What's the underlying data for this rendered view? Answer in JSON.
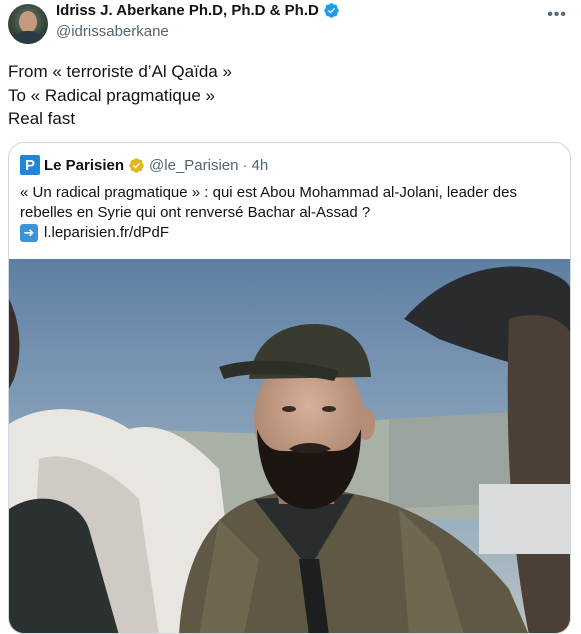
{
  "author": {
    "name": "Idriss J. Aberkane Ph.D, Ph.D & Ph.D",
    "handle": "@idrissaberkane",
    "more_icon": "more-horizontal-icon"
  },
  "tweet": {
    "lines": [
      "From « terroriste d’Al Qaïda »",
      "To « Radical pragmatique »",
      "Real fast"
    ]
  },
  "quote": {
    "logo_letter": "P",
    "source_name": "Le Parisien",
    "source_handle": "@le_Parisien",
    "separator": "·",
    "time": "4h",
    "text_line1": "« Un radical pragmatique » : qui est Abou Mohammad al-Jolani, leader des",
    "text_line2": "rebelles en Syrie qui ont renversé Bachar al-Assad ?",
    "link_text": "l.leparisien.fr/dPdF",
    "photo_label": "photo of a bearded man in a dark cap and olive jacket"
  },
  "colors": {
    "verified_blue": "#1d9bf0",
    "verified_gold": "#e2b719",
    "secondary_text": "#536471",
    "parisien_blue": "#1f87d7"
  }
}
